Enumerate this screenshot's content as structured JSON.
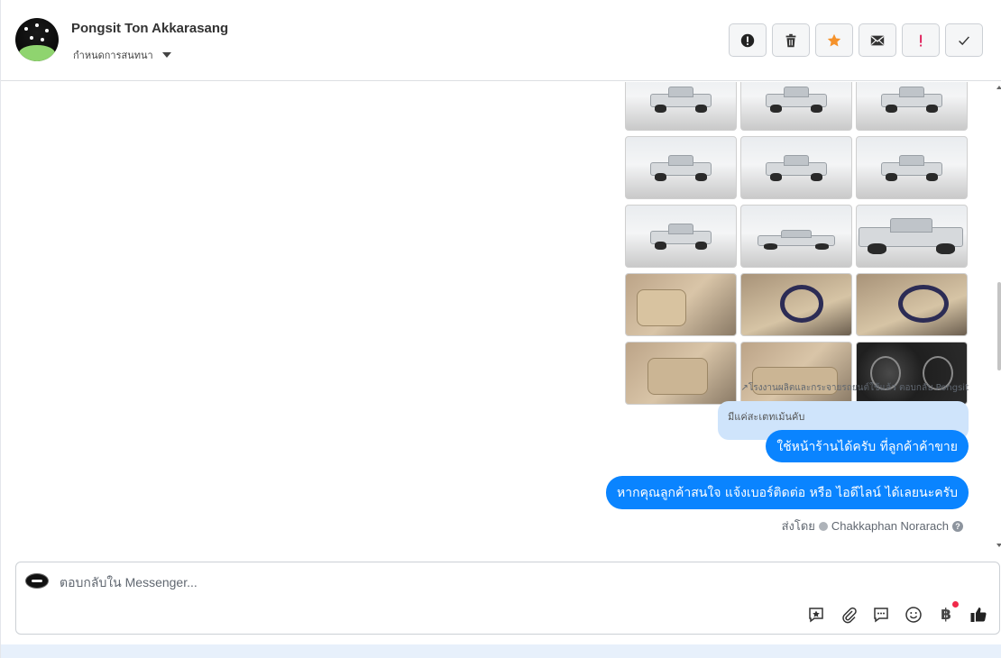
{
  "header": {
    "contact_name": "Pongsit Ton Akkarasang",
    "assign_label": "กำหนดการสนทนา",
    "actions": [
      {
        "name": "mark-spam-button",
        "icon": "alert-circle-icon"
      },
      {
        "name": "delete-button",
        "icon": "trash-icon"
      },
      {
        "name": "star-button",
        "icon": "star-icon",
        "color": "#f5922b"
      },
      {
        "name": "mark-unread-button",
        "icon": "envelope-icon"
      },
      {
        "name": "follow-up-button",
        "icon": "exclamation-icon",
        "color": "#e0245e"
      },
      {
        "name": "mark-done-button",
        "icon": "check-icon"
      }
    ]
  },
  "thread": {
    "photos": [
      {
        "kind": "exterior"
      },
      {
        "kind": "exterior"
      },
      {
        "kind": "exterior"
      },
      {
        "kind": "exterior"
      },
      {
        "kind": "exterior"
      },
      {
        "kind": "exterior"
      },
      {
        "kind": "exterior"
      },
      {
        "kind": "exterior"
      },
      {
        "kind": "exterior"
      },
      {
        "kind": "door"
      },
      {
        "kind": "steering"
      },
      {
        "kind": "steering"
      },
      {
        "kind": "seat"
      },
      {
        "kind": "seat"
      },
      {
        "kind": "dashboard"
      }
    ],
    "forward_note": "↗โรงงานผลิตและกระจายรถยนต์ใช้แล้ว ตอบกลับ Pongsit",
    "quoted_text": "มีแค่สะเตทเม้นคับ",
    "reply_message": "ใช้หน้าร้านได้ครับ ที่ลูกค้าค้าขาย",
    "second_message": "หากคุณลูกค้าสนใจ แจ้งเบอร์ติดต่อ หรือ ไอดีไลน์ ได้เลยนะครับ",
    "sent_by_label": "ส่งโดย",
    "sent_by_name": "Chakkaphan Norarach",
    "bubble_color": "#0a84ff"
  },
  "composer": {
    "placeholder": "ตอบกลับใน Messenger...",
    "tools": [
      "saved-reply-icon",
      "attachment-icon",
      "chat-bubbles-icon",
      "emoji-icon",
      "baht-icon",
      "like-icon"
    ],
    "baht_symbol": "฿"
  }
}
